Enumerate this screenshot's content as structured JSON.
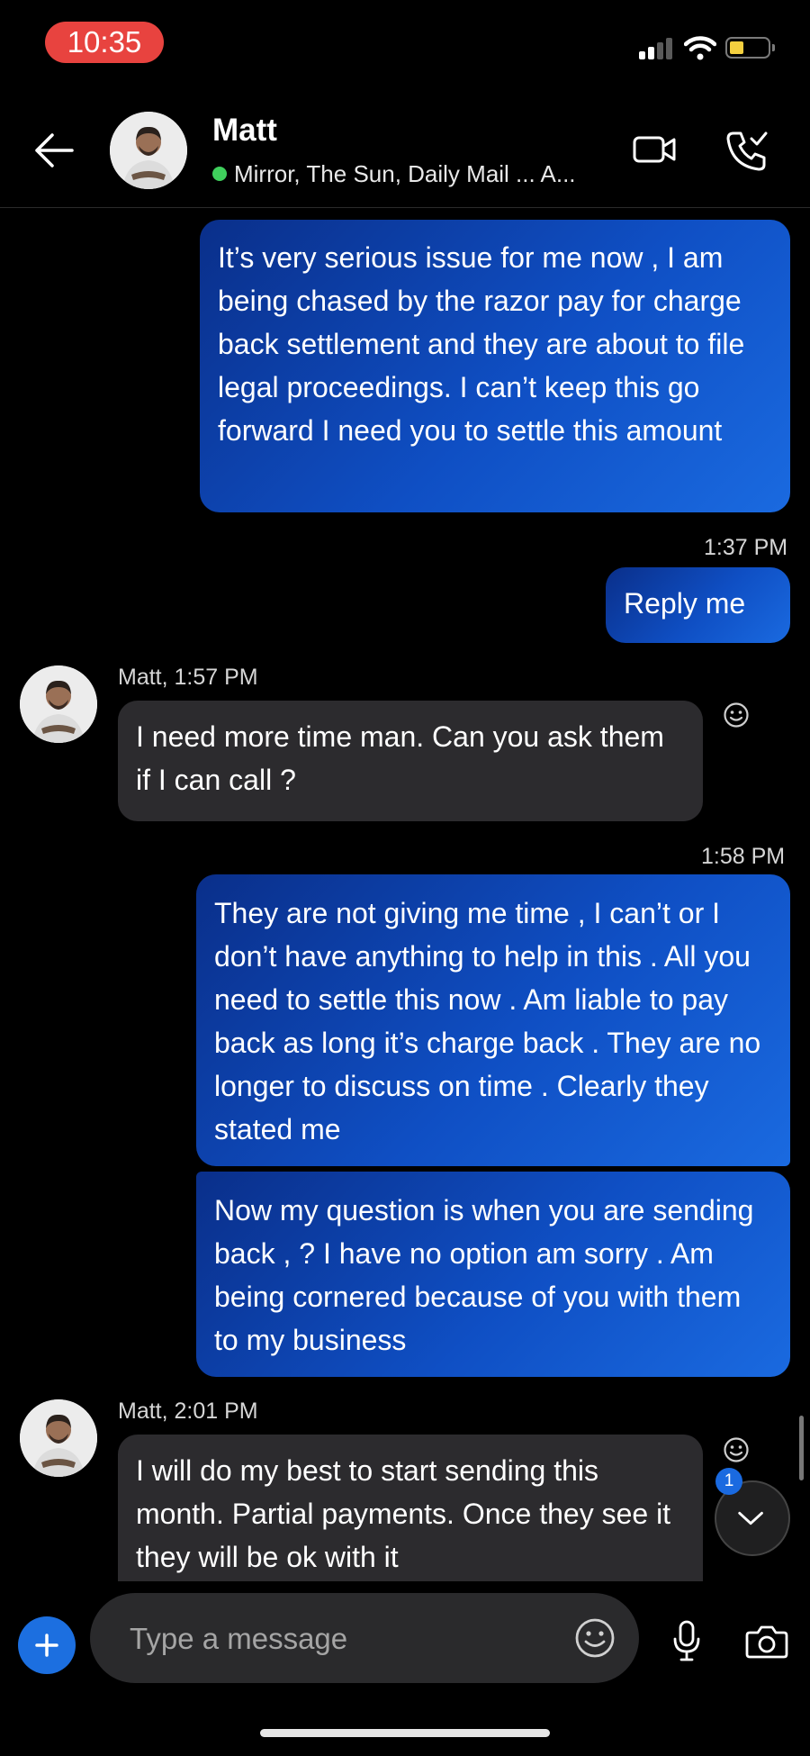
{
  "status_bar": {
    "time": "10:35"
  },
  "header": {
    "name": "Matt",
    "status": "Mirror, The Sun, Daily Mail ... A..."
  },
  "messages": {
    "out1": "It’s very serious issue for me now , I am being chased by the razor pay for charge back settlement and they are about to file legal proceedings. I can’t keep this go forward I need you to settle this amount",
    "stamp2": "1:37 PM",
    "out2": "Reply me",
    "in1_meta": "Matt, 1:57 PM",
    "in1": "I need more time man. Can you ask them if I can call ?",
    "stamp3": "1:58 PM",
    "out3": "They are not giving me time , I can’t or I don’t have anything to help in this . All you need to settle this now . Am liable to pay back as long it’s charge back . They are no longer to discuss on time . Clearly they stated me",
    "out4": "Now my question is when you are sending back , ? I have no option am sorry . Am being cornered because of you with them to my business",
    "in2_meta": "Matt, 2:01 PM",
    "in2": "I will do my best to start sending this month. Partial payments. Once they see it they will be ok with it"
  },
  "scroll_badge": "1",
  "composer": {
    "placeholder": "Type a message"
  }
}
